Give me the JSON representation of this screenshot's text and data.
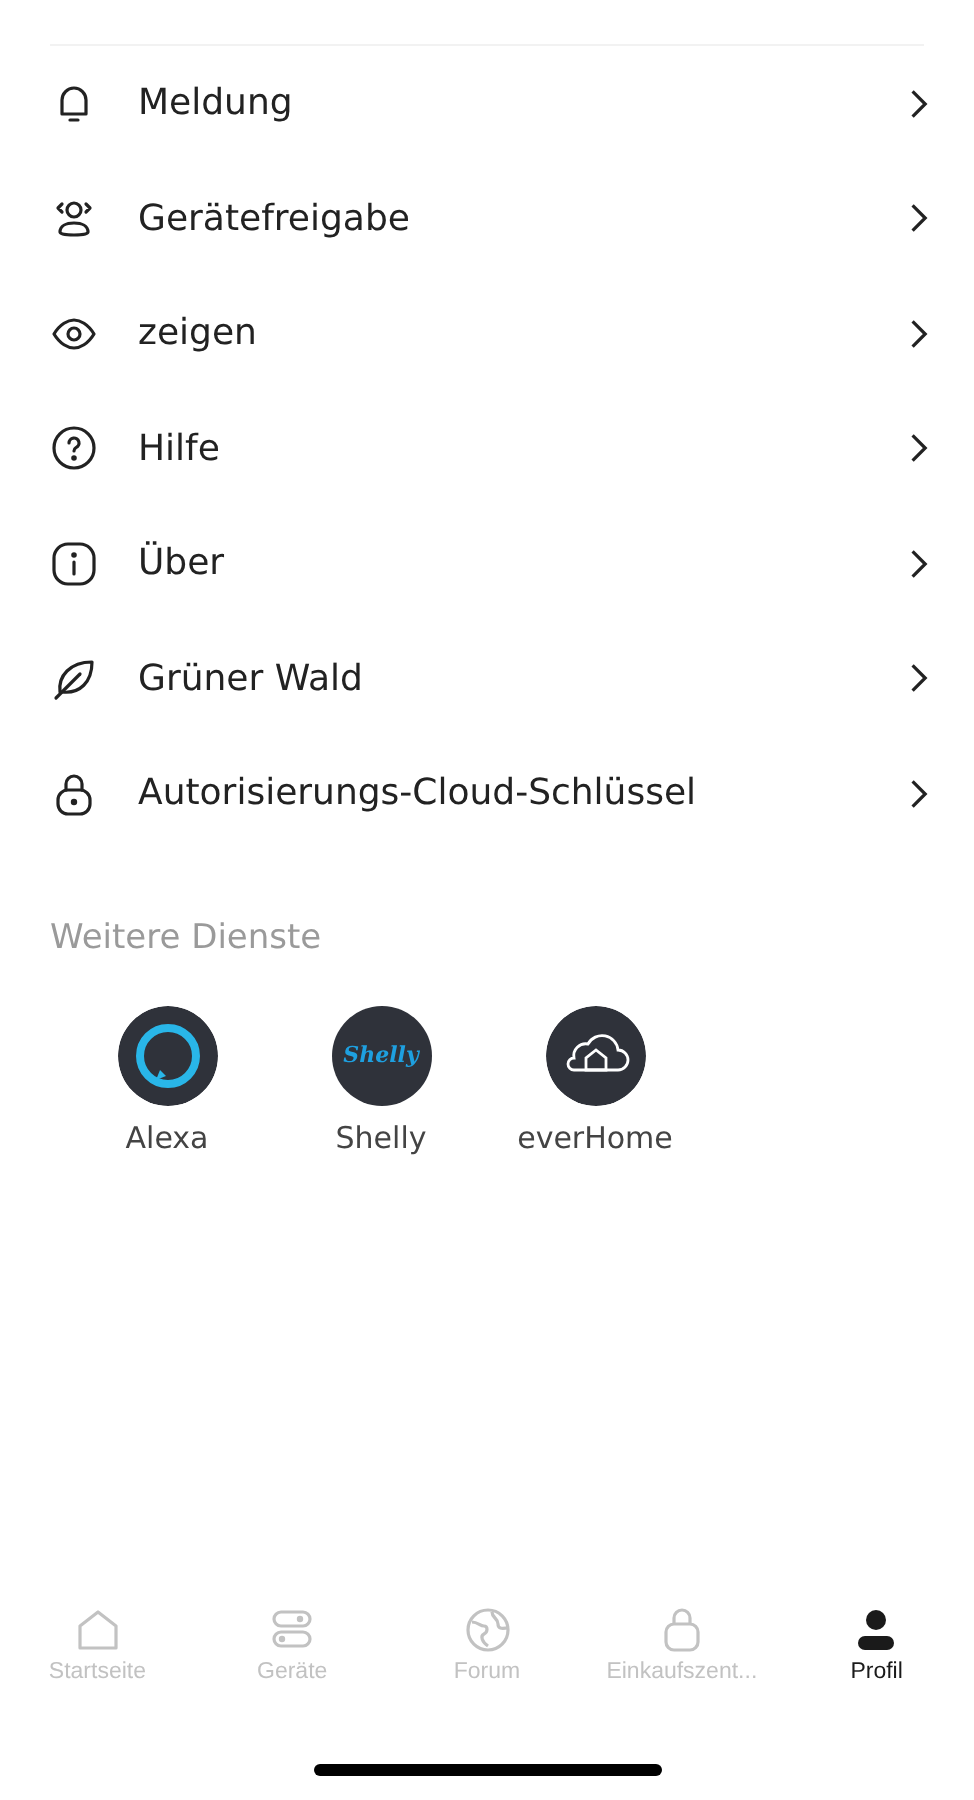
{
  "menu_items": [
    {
      "kind": "bell",
      "label": "Meldung"
    },
    {
      "kind": "users",
      "label": "Gerätefreigabe"
    },
    {
      "kind": "eye",
      "label": "zeigen"
    },
    {
      "kind": "help",
      "label": "Hilfe"
    },
    {
      "kind": "info",
      "label": "Über"
    },
    {
      "kind": "leaf",
      "label": "Grüner Wald"
    },
    {
      "kind": "lock",
      "label": "Autorisierungs-Cloud-Schlüssel"
    }
  ],
  "services": {
    "title": "Weitere Dienste",
    "items": [
      {
        "kind": "ring",
        "label": "Alexa"
      },
      {
        "kind": "wordmark",
        "logo_text": "Shelly",
        "label": "Shelly"
      },
      {
        "kind": "cloud",
        "label": "everHome"
      }
    ]
  },
  "tab_bar": [
    {
      "kind": "home",
      "label": "Startseite",
      "selected": false
    },
    {
      "kind": "devices",
      "label": "Geräte",
      "selected": false
    },
    {
      "kind": "globe",
      "label": "Forum",
      "selected": false
    },
    {
      "kind": "bag",
      "label": "Einkaufszent...",
      "selected": false
    },
    {
      "kind": "person",
      "label": "Profil",
      "selected": true
    }
  ]
}
